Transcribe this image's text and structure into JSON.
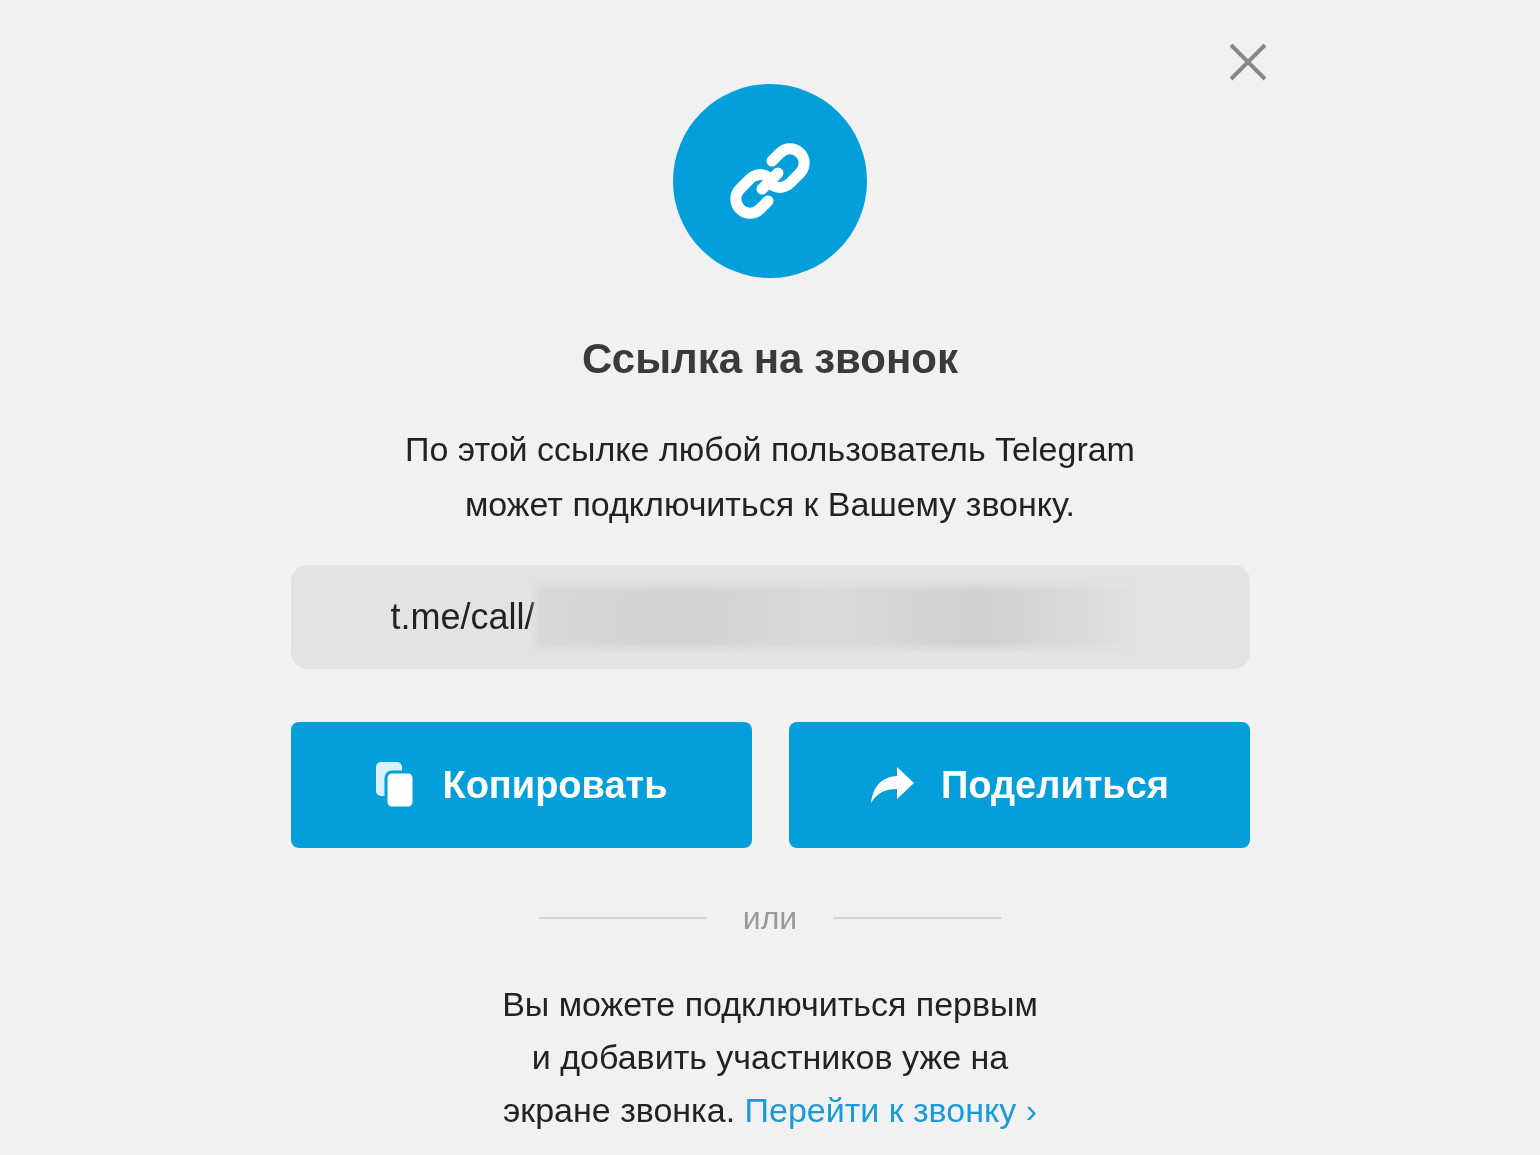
{
  "title": "Ссылка на звонок",
  "description": "По этой ссылке любой пользователь Telegram\nможет подключиться к Вашему звонку.",
  "link_field": {
    "value": "t.me/call/"
  },
  "buttons": [
    {
      "label": "Копировать",
      "kind": "copy"
    },
    {
      "label": "Поделиться",
      "kind": "share"
    }
  ],
  "divider_text": "или",
  "footer": {
    "text": "Вы можете подключиться первым\nи добавить участников уже на\nэкране звонка. ",
    "link": "Перейти к звонку ›"
  }
}
